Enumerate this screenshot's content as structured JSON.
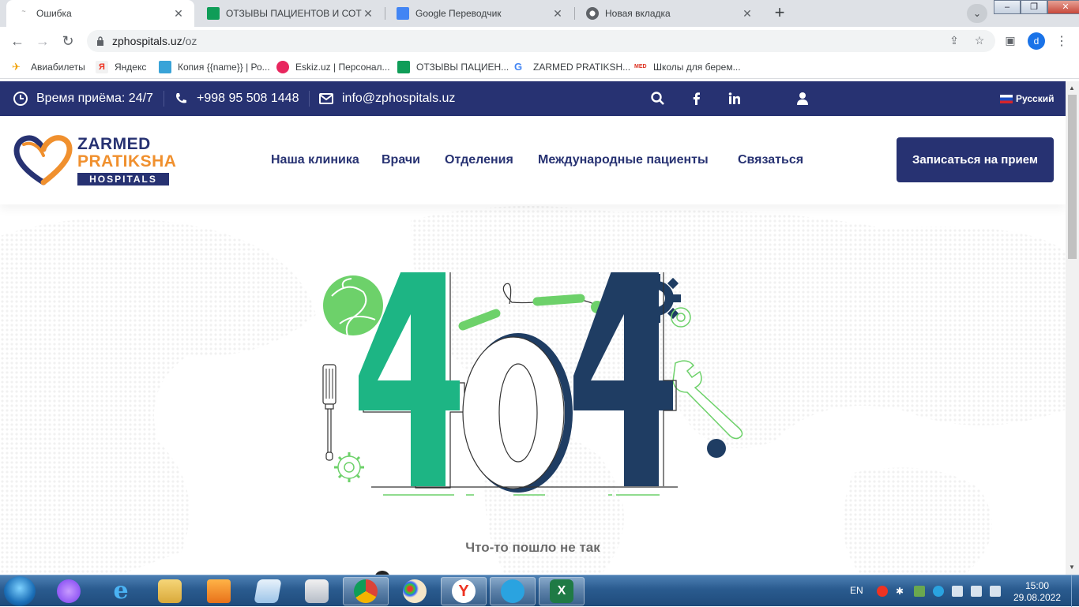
{
  "browser": {
    "tabs": [
      {
        "label": "Ошибка",
        "active": true
      },
      {
        "label": "ОТЗЫВЫ ПАЦИЕНТОВ И СОТРУДНИ",
        "active": false
      },
      {
        "label": "Google Переводчик",
        "active": false
      },
      {
        "label": "Новая вкладка",
        "active": false
      }
    ],
    "url_host": "zphospitals.uz",
    "url_path": "/oz",
    "profile_initial": "d",
    "bookmarks": [
      {
        "label": "Авиабилеты",
        "icon": "plane-icon"
      },
      {
        "label": "Яндекс",
        "icon": "yandex-icon"
      },
      {
        "label": "Копия {{name}} | Ро...",
        "icon": "page-icon"
      },
      {
        "label": "Eskiz.uz | Персонал...",
        "icon": "eskiz-icon"
      },
      {
        "label": "ОТЗЫВЫ ПАЦИЕН...",
        "icon": "sheets-icon"
      },
      {
        "label": "ZARMED PRATIKSH...",
        "icon": "google-icon"
      },
      {
        "label": "Школы для берем...",
        "icon": "med-icon"
      }
    ]
  },
  "site": {
    "topbar": {
      "hours": "Время приёма: 24/7",
      "phone": "+998 95 508 1448",
      "email": "info@zphospitals.uz",
      "language": "Русский"
    },
    "logo": {
      "line1": "ZARMED",
      "line2": "PRATIKSHA",
      "line3": "HOSPITALS"
    },
    "nav": [
      "Наша клиника",
      "Врачи",
      "Отделения",
      "Международные пациенты",
      "Связаться"
    ],
    "cta": "Записаться на прием",
    "error": {
      "code": "404",
      "message": "Что-то пошло не так"
    },
    "colors": {
      "navy": "#273272",
      "green": "#1db584",
      "orange": "#f0902e"
    }
  },
  "taskbar": {
    "language": "EN",
    "time": "15:00",
    "date": "29.08.2022"
  }
}
